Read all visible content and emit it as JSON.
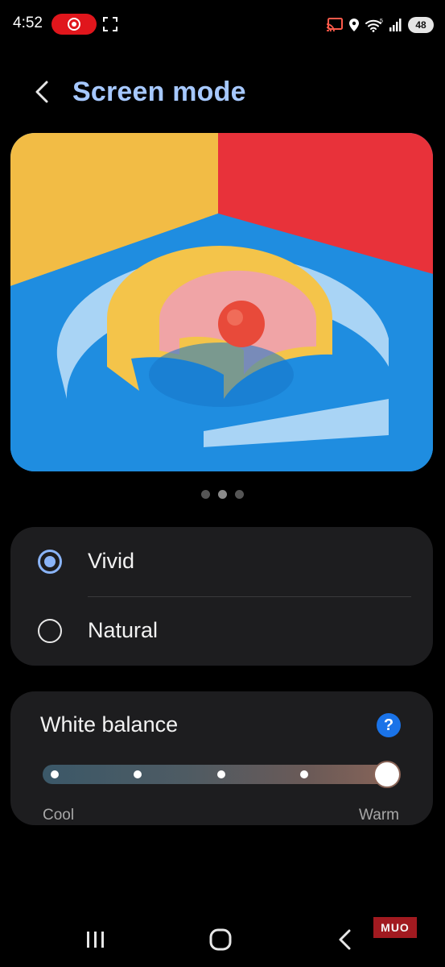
{
  "status_bar": {
    "time": "4:52",
    "battery": "48",
    "icons": [
      "record-icon",
      "screenshot-icon",
      "cast-icon",
      "location-icon",
      "wifi-icon",
      "signal-icon",
      "battery-icon"
    ]
  },
  "header": {
    "title": "Screen mode",
    "back_icon": "chevron-left-icon"
  },
  "preview": {
    "pages": 3,
    "active_page": 1
  },
  "screen_mode": {
    "options": [
      {
        "label": "Vivid",
        "selected": true
      },
      {
        "label": "Natural",
        "selected": false
      }
    ]
  },
  "white_balance": {
    "title": "White balance",
    "help_icon": "help-icon",
    "help_glyph": "?",
    "min_label": "Cool",
    "max_label": "Warm",
    "steps": 5,
    "value_step": 5
  },
  "nav_bar": {
    "buttons": [
      "recent-apps-icon",
      "home-icon",
      "back-icon"
    ]
  },
  "watermark": "MUO",
  "colors": {
    "accent": "#a6c8ff",
    "radio_on": "#8ab4f8",
    "card_bg": "#1d1d1f",
    "help_bg": "#1a73e8"
  }
}
